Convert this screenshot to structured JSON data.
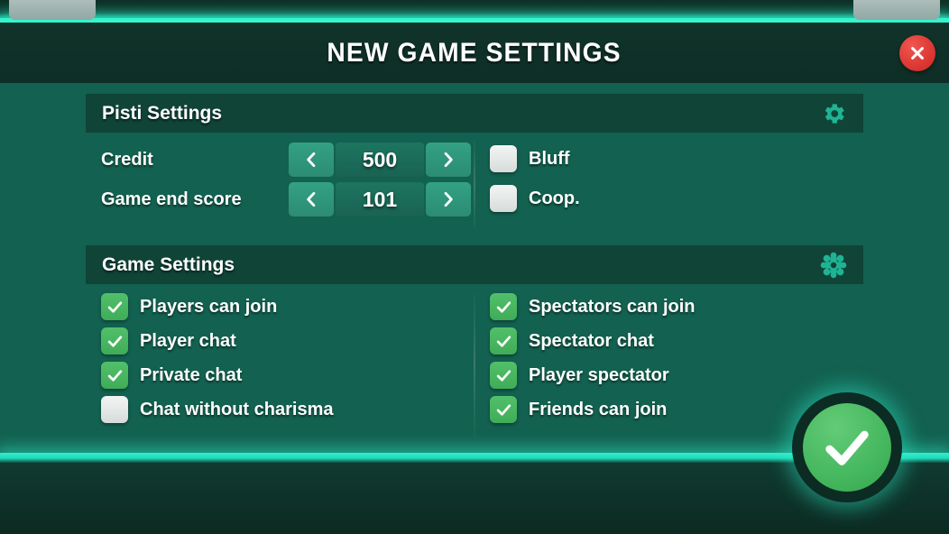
{
  "window": {
    "title": "NEW GAME SETTINGS",
    "close_icon": "close-x-icon",
    "corner_tab_left": "",
    "corner_tab_right": ""
  },
  "colors": {
    "header_bg": "#0e2e26",
    "body_bg": "#136150",
    "section_bar": "#0f4437",
    "accent_cyan": "#2ff0cd",
    "checkbox_on": "#46b85f",
    "checkbox_off": "#e9eeec",
    "stepper_btn": "#2f9a80",
    "close_red": "#d8342f",
    "confirm_green": "#46b85f"
  },
  "pisti_section": {
    "title": "Pisti Settings",
    "icon": "gear-icon",
    "steppers": [
      {
        "label": "Credit",
        "value": "500",
        "prev_icon": "chevron-left-icon",
        "next_icon": "chevron-right-icon"
      },
      {
        "label": "Game end score",
        "value": "101",
        "prev_icon": "chevron-left-icon",
        "next_icon": "chevron-right-icon"
      }
    ],
    "toggles": [
      {
        "label": "Bluff",
        "checked": false
      },
      {
        "label": "Coop.",
        "checked": false
      }
    ]
  },
  "game_section": {
    "title": "Game Settings",
    "icon": "cog-knob-icon",
    "left_column": [
      {
        "label": "Players can join",
        "checked": true
      },
      {
        "label": "Player chat",
        "checked": true
      },
      {
        "label": "Private chat",
        "checked": true
      },
      {
        "label": "Chat without charisma",
        "checked": false
      }
    ],
    "right_column": [
      {
        "label": "Spectators can join",
        "checked": true
      },
      {
        "label": "Spectator chat",
        "checked": true
      },
      {
        "label": "Player spectator",
        "checked": true
      },
      {
        "label": "Friends can join",
        "checked": true
      }
    ]
  },
  "confirm": {
    "icon": "check-icon",
    "label": ""
  }
}
